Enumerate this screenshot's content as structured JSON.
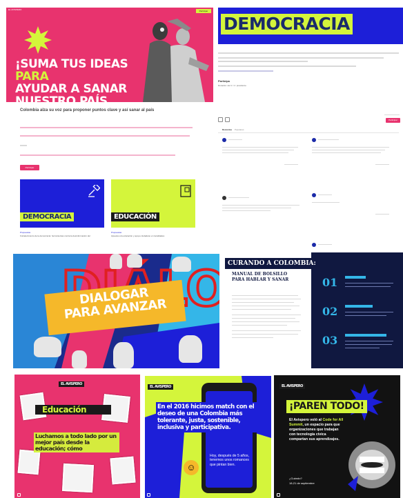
{
  "hero": {
    "corner_left": "EL AVISPERO",
    "corner_button": "Participar",
    "headline_white": "¡SUMA TUS IDEAS",
    "headline_yellow": "PARA",
    "headline_line2": "AYUDAR A SANAR",
    "headline_line3": "NUESTRO PAÍS AQUÍ!",
    "colors": {
      "pink": "#e8336e",
      "lime": "#d4f53b",
      "blue": "#1d1fd8",
      "navy": "#1a2b6b"
    }
  },
  "democracia_page": {
    "banner_title": "DEMOCRACIA",
    "participa_label": "Participa",
    "participa_sub": "Duración: del 1 / 1 / presidente"
  },
  "colombia_section": {
    "heading": "Colombia alza su voz para proponer puntos clave y así sanar al país",
    "button": "Participar",
    "cards": [
      {
        "label": "DEMOCRACIA",
        "kicker": "Propuestas",
        "text": "Fortalecimiento de la democracia: herramientas contra la desinformación del",
        "icon": "hammer-icon"
      },
      {
        "label": "EDUCACIÓN",
        "kicker": "Propuestas",
        "text": "Apuesta a la educación y apoyo ciudadano en localidades",
        "icon": "book-icon"
      }
    ]
  },
  "comments_panel": {
    "tabs": [
      "Recientes",
      "Populares"
    ],
    "button": "Participar",
    "icons": [
      "grid-icon",
      "list-icon"
    ]
  },
  "dialogar": {
    "headline": "DIALOGAR PARA AVANZAR",
    "bg_letters": "DIÁLOGO"
  },
  "curando": {
    "title": "CURANDO A COLOMBIA:",
    "subtitle": "MANUAL DE BOLSILLO PARA HABLAR Y SANAR",
    "numbers": [
      "01",
      "02",
      "03"
    ]
  },
  "posts": [
    {
      "brand": "EL AVISPERO",
      "word": "Educación",
      "phrase": "Luchamos a todo lado por un mejor país desde la educación; cómo",
      "icon": "instagram-icon"
    },
    {
      "brand": "EL AVISPERO",
      "headline": "En el 2016 hicimos match con el deseo de una Colombia más tolerante, justa, sostenible, inclusiva y participativa.",
      "bubble": "Hoy, después de 5 años, tenemos unos romances que pintan bien.",
      "emoji": "face-icon"
    },
    {
      "brand": "EL AVISPERO",
      "headline": "¡PAREN TODO!",
      "body_prefix": "El Avispero voló al ",
      "body_highlight": "Code for All Summit",
      "body_suffix": ", un espacio para que organizaciones que trabajan con tecnología cívica compartan sus aprendizajes.",
      "question": "¿Cuándo?",
      "dates": "18-21 de septiembre"
    }
  ]
}
